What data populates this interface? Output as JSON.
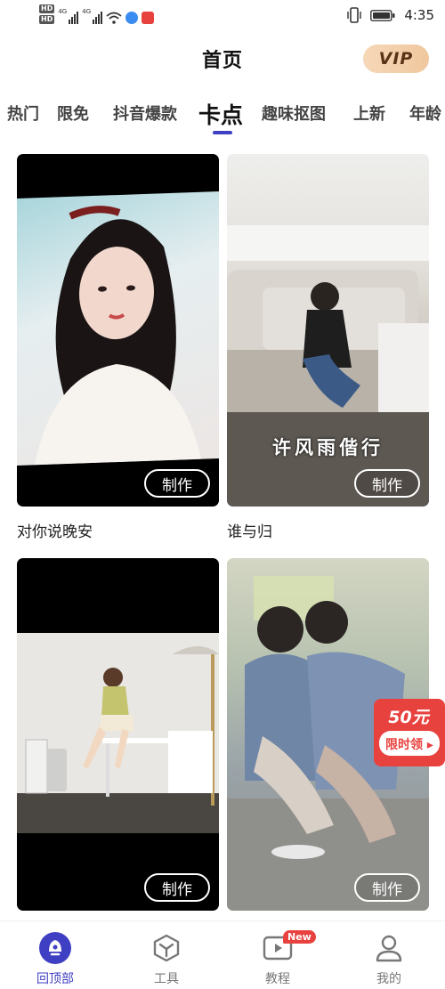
{
  "status_bar": {
    "hd_top": "HD",
    "hd_bottom": "HD",
    "net1": "4G",
    "net2": "4G",
    "time": "4:35"
  },
  "header": {
    "title": "首页",
    "vip_label": "VIP"
  },
  "tabs": [
    {
      "label": "热门"
    },
    {
      "label": "限免"
    },
    {
      "label": "抖音爆款"
    },
    {
      "label": "卡点",
      "active": true
    },
    {
      "label": "趣味抠图"
    },
    {
      "label": "上新"
    },
    {
      "label": "年龄"
    }
  ],
  "cards": [
    {
      "title": "对你说晚安",
      "make_label": "制作",
      "overlay_text": ""
    },
    {
      "title": "谁与归",
      "make_label": "制作",
      "overlay_text": "许风雨偕行"
    },
    {
      "title": "",
      "make_label": "制作",
      "overlay_text": ""
    },
    {
      "title": "",
      "make_label": "制作",
      "overlay_text": ""
    }
  ],
  "promo": {
    "amount": "50元",
    "action": "限时领"
  },
  "bottom_nav": [
    {
      "label": "回顶部",
      "icon": "back-to-top-icon",
      "active": true
    },
    {
      "label": "工具",
      "icon": "cube-icon"
    },
    {
      "label": "教程",
      "icon": "play-icon",
      "badge": "New"
    },
    {
      "label": "我的",
      "icon": "person-icon"
    }
  ],
  "colors": {
    "accent": "#3f3fc4",
    "vip_gold": "#f0c79e",
    "promo_red": "#e8423f"
  }
}
